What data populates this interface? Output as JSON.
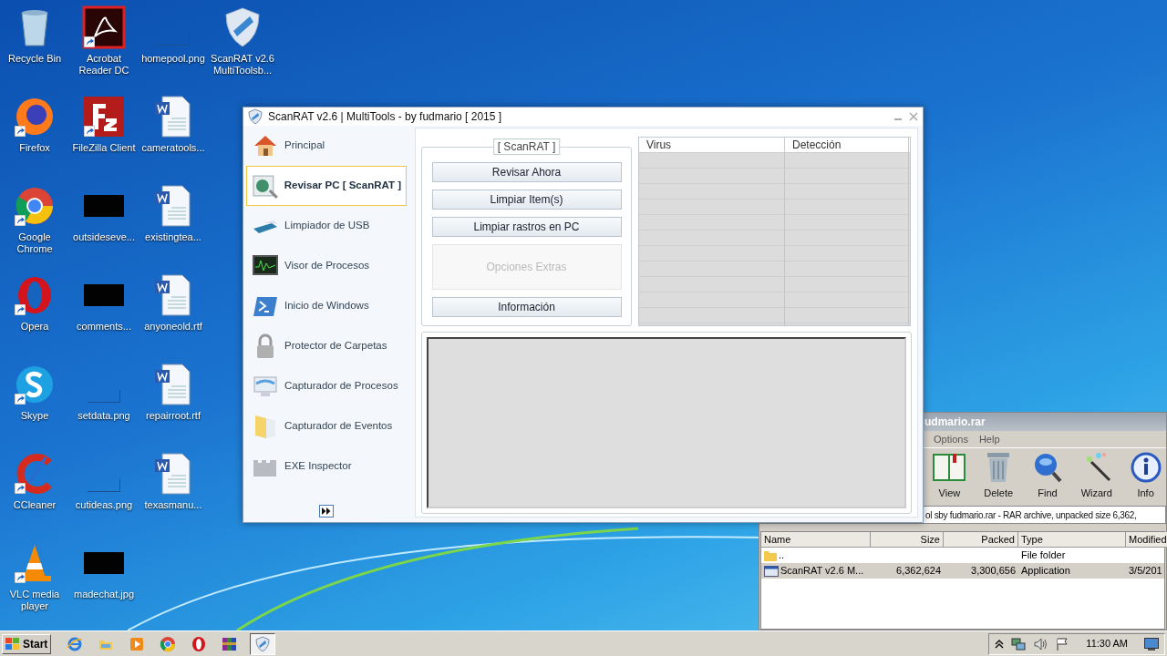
{
  "desktop_icons": [
    [
      {
        "label": "Recycle Bin",
        "kind": "recycle",
        "shortcut": false
      },
      {
        "label": "Firefox",
        "kind": "firefox",
        "shortcut": true
      },
      {
        "label": "Google Chrome",
        "kind": "chrome",
        "shortcut": true
      },
      {
        "label": "Opera",
        "kind": "opera",
        "shortcut": true
      },
      {
        "label": "Skype",
        "kind": "skype",
        "shortcut": true
      },
      {
        "label": "CCleaner",
        "kind": "ccleaner",
        "shortcut": true
      },
      {
        "label": "VLC media player",
        "kind": "vlc",
        "shortcut": true
      }
    ],
    [
      {
        "label": "Acrobat Reader DC",
        "kind": "acrobat",
        "shortcut": true
      },
      {
        "label": "FileZilla Client",
        "kind": "filezilla",
        "shortcut": true
      },
      {
        "label": "outsideseve...",
        "kind": "dark-image",
        "shortcut": false
      },
      {
        "label": "comments...",
        "kind": "dark-image",
        "shortcut": false
      },
      {
        "label": "setdata.png",
        "kind": "blank-image",
        "shortcut": false
      },
      {
        "label": "cutideas.png",
        "kind": "blank-image",
        "shortcut": false
      },
      {
        "label": "madechat.jpg",
        "kind": "dark-image",
        "shortcut": false
      }
    ],
    [
      {
        "label": "homepool.png",
        "kind": "blank-image",
        "shortcut": false
      },
      {
        "label": "cameratools...",
        "kind": "word",
        "shortcut": false
      },
      {
        "label": "existingtea...",
        "kind": "word",
        "shortcut": false
      },
      {
        "label": "anyoneold.rtf",
        "kind": "word",
        "shortcut": false
      },
      {
        "label": "repairroot.rtf",
        "kind": "word",
        "shortcut": false
      },
      {
        "label": "texasmanu...",
        "kind": "word",
        "shortcut": false
      }
    ],
    [
      {
        "label": "ScanRAT v2.6 MultiToolsb...",
        "kind": "shield",
        "shortcut": false
      }
    ]
  ],
  "scanrat_window": {
    "title": "ScanRAT v2.6 | MultiTools - by fudmario [ 2015 ]",
    "sidebar": [
      {
        "label": "Principal",
        "kind": "house",
        "selected": false
      },
      {
        "label": "Revisar PC [ ScanRAT ]",
        "kind": "scanner",
        "selected": true
      },
      {
        "label": "Limpiador de USB",
        "kind": "usb",
        "selected": false
      },
      {
        "label": "Visor de Procesos",
        "kind": "graph",
        "selected": false
      },
      {
        "label": "Inicio de Windows",
        "kind": "terminal",
        "selected": false
      },
      {
        "label": "Protector de Carpetas",
        "kind": "lock",
        "selected": false
      },
      {
        "label": "Capturador de Procesos",
        "kind": "monitor",
        "selected": false
      },
      {
        "label": "Capturador de Eventos",
        "kind": "folder",
        "selected": false
      },
      {
        "label": "EXE Inspector",
        "kind": "wall",
        "selected": false
      }
    ],
    "group_title": "[ ScanRAT ]",
    "buttons": [
      {
        "label": "Revisar Ahora",
        "disabled": false
      },
      {
        "label": "Limpiar Item(s)",
        "disabled": false
      },
      {
        "label": "Limpiar rastros en PC",
        "disabled": false
      },
      {
        "label": "Opciones Extras",
        "disabled": true
      },
      {
        "label": "Información",
        "disabled": false
      }
    ],
    "table_columns": [
      "Virus",
      "Detección"
    ]
  },
  "winrar_window": {
    "title": "udmario.rar",
    "menu": [
      "Options",
      "Help"
    ],
    "toolbar": [
      {
        "label": "View",
        "kind": "book"
      },
      {
        "label": "Delete",
        "kind": "trash"
      },
      {
        "label": "Find",
        "kind": "magnifier"
      },
      {
        "label": "Wizard",
        "kind": "wand"
      },
      {
        "label": "Info",
        "kind": "info"
      }
    ],
    "address": "ol sby fudmario.rar - RAR archive, unpacked size 6,362,",
    "columns": [
      "Name",
      "Size",
      "Packed",
      "Type",
      "Modified"
    ],
    "rows": [
      {
        "kind": "folder",
        "selected": false,
        "cells": [
          "..",
          "",
          "",
          "File folder",
          ""
        ]
      },
      {
        "kind": "app",
        "selected": true,
        "cells": [
          "ScanRAT v2.6 M...",
          "6,362,624",
          "3,300,656",
          "Application",
          "3/5/201"
        ]
      }
    ]
  },
  "taskbar": {
    "start": "Start",
    "apps": [
      {
        "kind": "ie",
        "active": false
      },
      {
        "kind": "explorer",
        "active": false
      },
      {
        "kind": "media",
        "active": false
      },
      {
        "kind": "chrome",
        "active": false
      },
      {
        "kind": "opera",
        "active": false
      },
      {
        "kind": "winrar",
        "active": false
      },
      {
        "kind": "shield",
        "active": true
      }
    ],
    "clock": "11:30 AM"
  }
}
